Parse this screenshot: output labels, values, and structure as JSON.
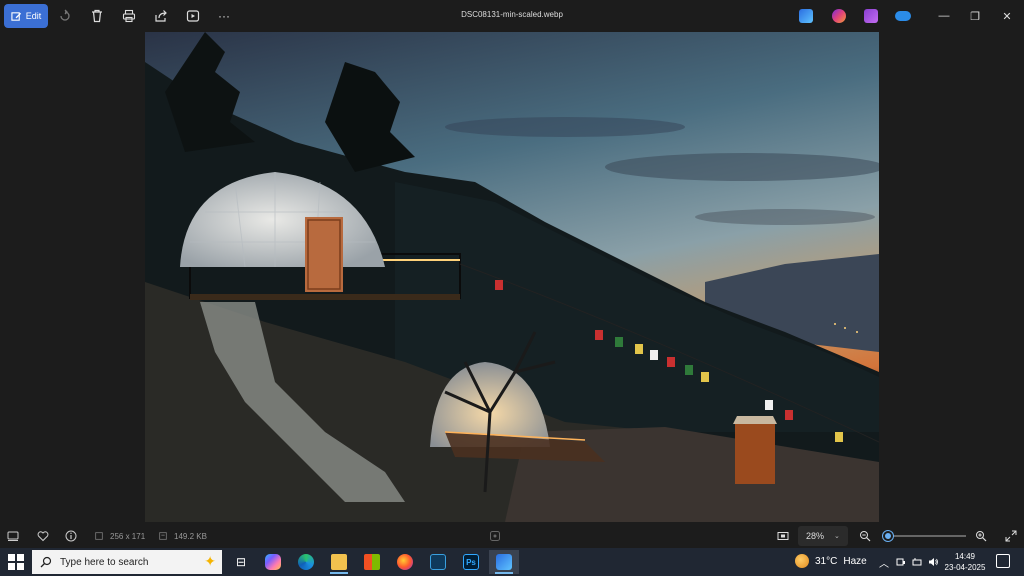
{
  "toolbar": {
    "edit_label": "Edit",
    "file_title": "DSC08131-min-scaled.webp",
    "icons": [
      "edit-icon",
      "rotate-icon",
      "delete-icon",
      "print-icon",
      "share-icon",
      "slideshow-icon",
      "more-icon"
    ],
    "more_label": "···",
    "apps": [
      "photos-editor",
      "clipchamp",
      "media-app",
      "onedrive"
    ],
    "window_controls": {
      "minimize": "—",
      "maximize": "❐",
      "close": "✕"
    }
  },
  "photo": {
    "subject": "glamping dome on mountainside at dusk"
  },
  "statusbar": {
    "dimensions": "256 x 171",
    "file_size": "149.2 KB",
    "zoom": "28%",
    "zoom_chevron": "⌄",
    "zoom_level": 0.05
  },
  "taskbar": {
    "search_placeholder": "Type here to search",
    "weather": {
      "temp": "31°C",
      "condition": "Haze"
    },
    "time": "14:49",
    "date": "23-04-2025",
    "tray_up": "︿",
    "apps": [
      {
        "name": "task-view",
        "label": "⊟"
      },
      {
        "name": "copilot",
        "label": ""
      },
      {
        "name": "edge",
        "label": ""
      },
      {
        "name": "file-explorer",
        "label": ""
      },
      {
        "name": "microsoft-store",
        "label": ""
      },
      {
        "name": "firefox",
        "label": ""
      },
      {
        "name": "media-player",
        "label": ""
      },
      {
        "name": "photoshop",
        "label": "Ps"
      },
      {
        "name": "photos",
        "label": ""
      }
    ]
  },
  "colors": {
    "accent": "#3b6fd4",
    "background": "#1c1c1c",
    "taskbar": "#202733",
    "slider": "#6ab0f3"
  }
}
